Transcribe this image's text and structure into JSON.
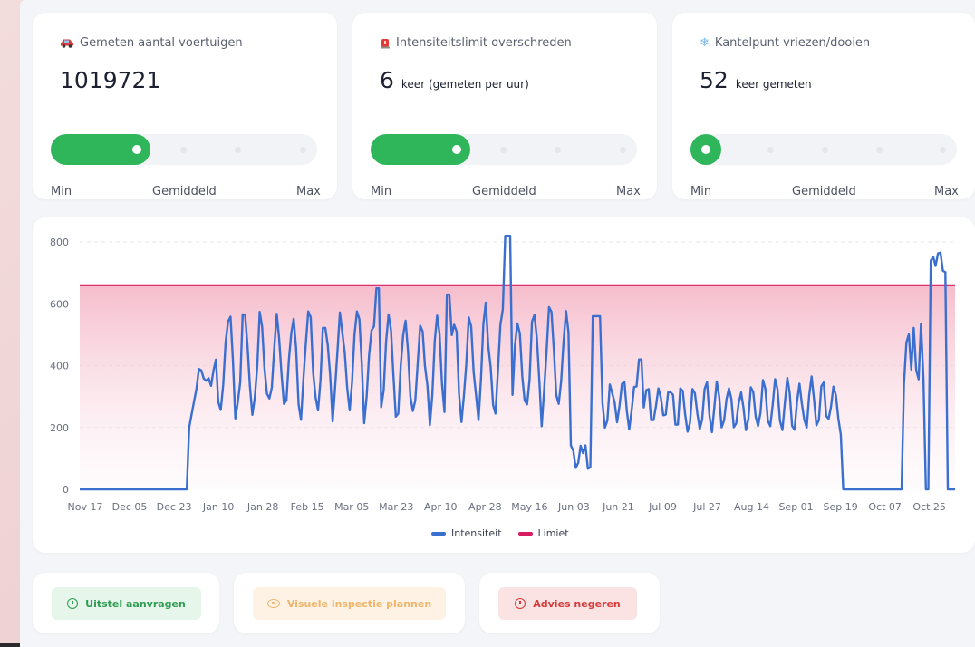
{
  "stats": [
    {
      "icon": "car-icon",
      "title": "Gemeten aantal voertuigen",
      "value": "1019721",
      "unit": "",
      "level": 0.37,
      "scale": {
        "min": "Min",
        "avg": "Gemiddeld",
        "max": "Max"
      }
    },
    {
      "icon": "alarm-icon",
      "title": "Intensiteitslimit overschreden",
      "value": "6",
      "unit": "keer (gemeten per uur)",
      "level": 0.37,
      "scale": {
        "min": "Min",
        "avg": "Gemiddeld",
        "max": "Max"
      }
    },
    {
      "icon": "snowflake-icon",
      "title": "Kantelpunt vriezen/dooien",
      "value": "52",
      "unit": "keer gemeten",
      "level": 0.0,
      "scale": {
        "min": "Min",
        "avg": "Gemiddeld",
        "max": "Max"
      }
    }
  ],
  "chart_data": {
    "type": "line",
    "title": "",
    "xlabel": "",
    "ylabel": "",
    "ylim": [
      0,
      850
    ],
    "yticks": [
      0,
      200,
      400,
      600,
      800
    ],
    "grid": "horizontal dashed",
    "legend_position": "bottom",
    "x_tick_labels": [
      "Nov 17",
      "Dec 05",
      "Dec 23",
      "Jan 10",
      "Jan 28",
      "Feb 15",
      "Mar 05",
      "Mar 23",
      "Apr 10",
      "Apr 28",
      "May 16",
      "Jun 03",
      "Jun 21",
      "Jul 09",
      "Jul 27",
      "Aug 14",
      "Sep 01",
      "Sep 19",
      "Oct 07",
      "Oct 25"
    ],
    "series": [
      {
        "name": "Intensiteit",
        "color": "#3a6fd0"
      },
      {
        "name": "Limiet",
        "color": "#d81b60",
        "value": 660
      }
    ]
  },
  "actions": [
    {
      "label": "Uitstel aanvragen",
      "icon": "clock-icon",
      "color": "#2e9c52",
      "bg": "#e6f6ea"
    },
    {
      "label": "Visuele inspectie plannen",
      "icon": "eye-icon",
      "color": "#f0b46a",
      "bg": "#fdf2e3"
    },
    {
      "label": "Advies negeren",
      "icon": "clock-icon",
      "color": "#d83a3a",
      "bg": "#fbe3e3"
    }
  ]
}
